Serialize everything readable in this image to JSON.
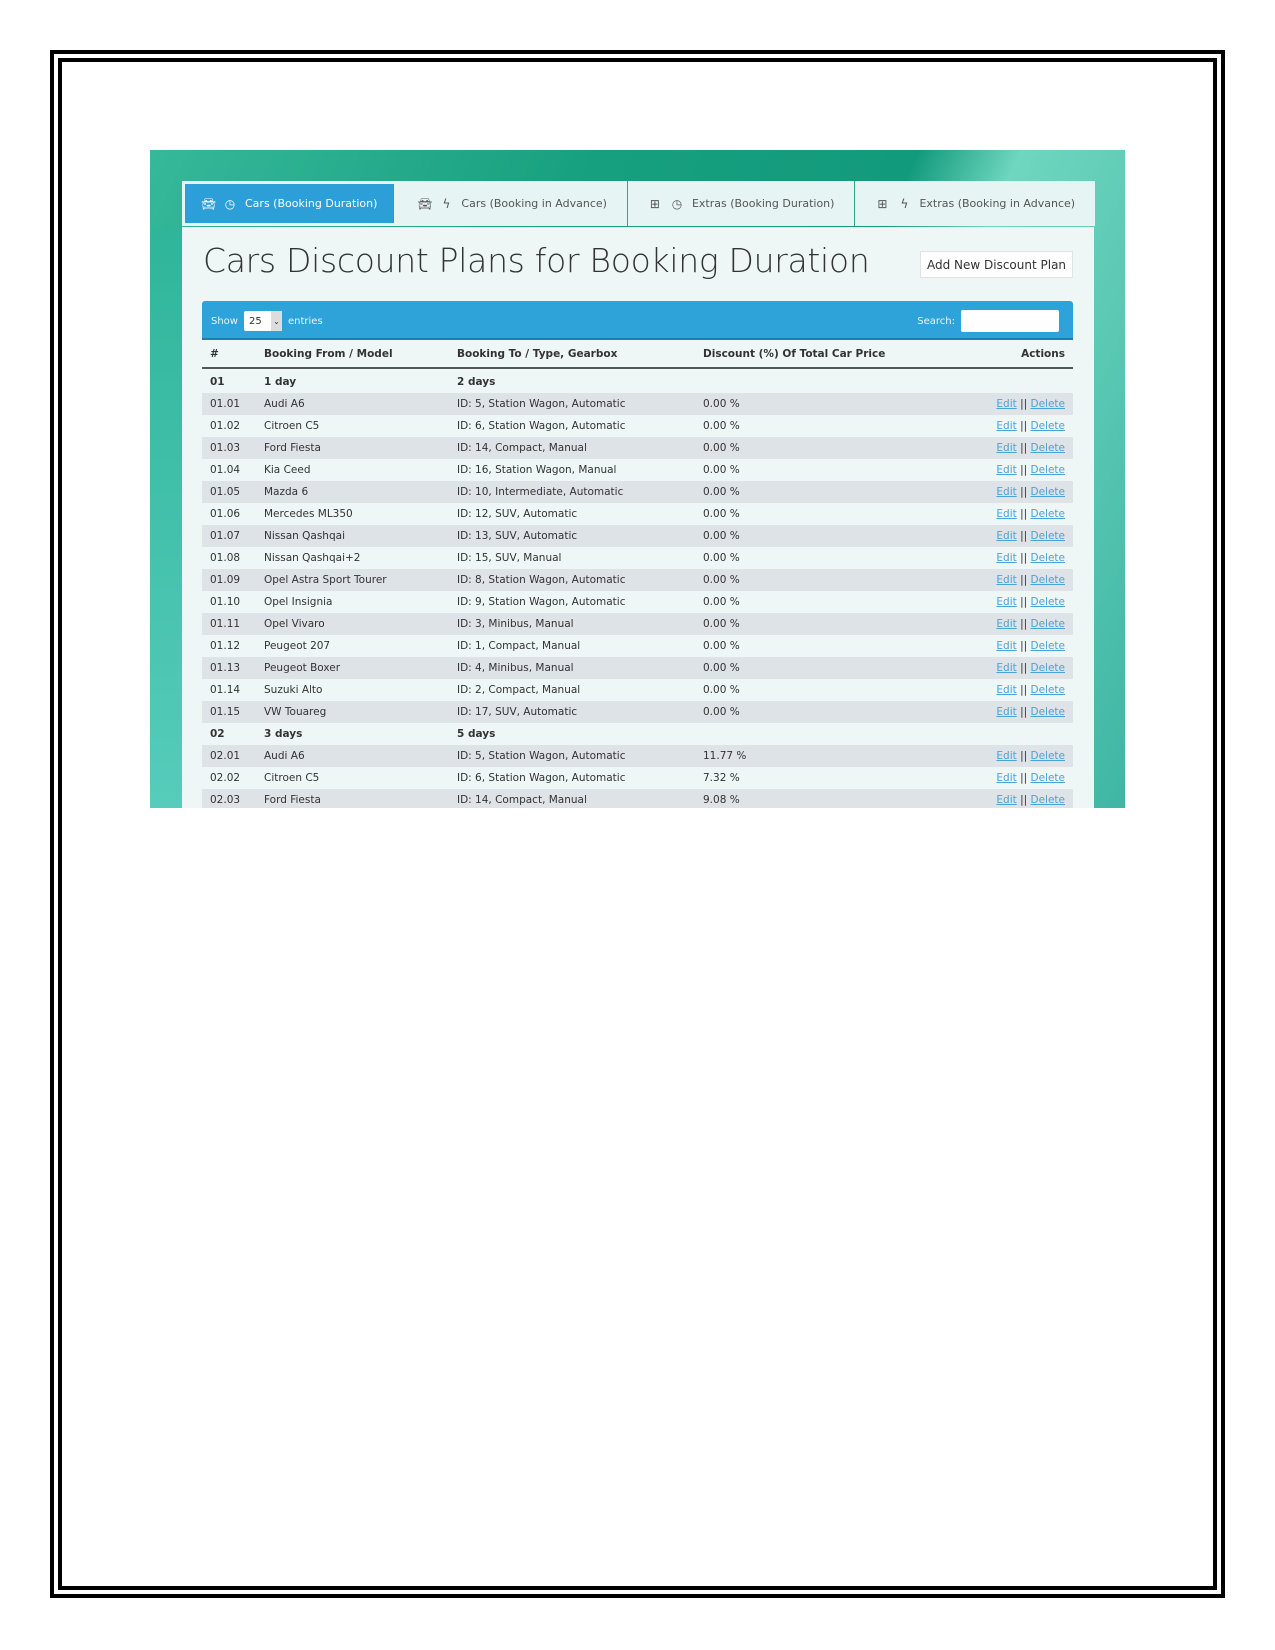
{
  "tabs": [
    {
      "label": "Cars (Booking Duration)",
      "icons": [
        "car-icon",
        "clock-icon"
      ],
      "active": true
    },
    {
      "label": "Cars (Booking in Advance)",
      "icons": [
        "car-icon",
        "bolt-icon"
      ]
    },
    {
      "label": "Extras (Booking Duration)",
      "icons": [
        "plus-square-icon",
        "clock-icon"
      ]
    },
    {
      "label": "Extras (Booking in Advance)",
      "icons": [
        "plus-square-icon",
        "bolt-icon"
      ]
    }
  ],
  "page_title": "Cars Discount Plans for Booking Duration",
  "add_button": "Add New Discount Plan",
  "toolbar": {
    "show_label": "Show",
    "entries_value": "25",
    "entries_label": "entries",
    "search_label": "Search:",
    "search_value": ""
  },
  "columns": [
    "#",
    "Booking From / Model",
    "Booking To / Type, Gearbox",
    "Discount (%) Of Total Car Price",
    "Actions"
  ],
  "action_labels": {
    "edit": "Edit",
    "separator": "||",
    "delete": "Delete"
  },
  "rows": [
    {
      "id": "01",
      "from": "1 day",
      "to": "2 days",
      "discount": "",
      "group": true
    },
    {
      "id": "01.01",
      "from": "Audi A6",
      "to": "ID: 5, Station Wagon, Automatic",
      "discount": "0.00 %"
    },
    {
      "id": "01.02",
      "from": "Citroen C5",
      "to": "ID: 6, Station Wagon, Automatic",
      "discount": "0.00 %"
    },
    {
      "id": "01.03",
      "from": "Ford Fiesta",
      "to": "ID: 14, Compact, Manual",
      "discount": "0.00 %"
    },
    {
      "id": "01.04",
      "from": "Kia Ceed",
      "to": "ID: 16, Station Wagon, Manual",
      "discount": "0.00 %"
    },
    {
      "id": "01.05",
      "from": "Mazda 6",
      "to": "ID: 10, Intermediate, Automatic",
      "discount": "0.00 %"
    },
    {
      "id": "01.06",
      "from": "Mercedes ML350",
      "to": "ID: 12, SUV, Automatic",
      "discount": "0.00 %"
    },
    {
      "id": "01.07",
      "from": "Nissan Qashqai",
      "to": "ID: 13, SUV, Automatic",
      "discount": "0.00 %"
    },
    {
      "id": "01.08",
      "from": "Nissan Qashqai+2",
      "to": "ID: 15, SUV, Manual",
      "discount": "0.00 %"
    },
    {
      "id": "01.09",
      "from": "Opel Astra Sport Tourer",
      "to": "ID: 8, Station Wagon, Automatic",
      "discount": "0.00 %"
    },
    {
      "id": "01.10",
      "from": "Opel Insignia",
      "to": "ID: 9, Station Wagon, Automatic",
      "discount": "0.00 %"
    },
    {
      "id": "01.11",
      "from": "Opel Vivaro",
      "to": "ID: 3, Minibus, Manual",
      "discount": "0.00 %"
    },
    {
      "id": "01.12",
      "from": "Peugeot 207",
      "to": "ID: 1, Compact, Manual",
      "discount": "0.00 %"
    },
    {
      "id": "01.13",
      "from": "Peugeot Boxer",
      "to": "ID: 4, Minibus, Manual",
      "discount": "0.00 %"
    },
    {
      "id": "01.14",
      "from": "Suzuki Alto",
      "to": "ID: 2, Compact, Manual",
      "discount": "0.00 %"
    },
    {
      "id": "01.15",
      "from": "VW Touareg",
      "to": "ID: 17, SUV, Automatic",
      "discount": "0.00 %"
    },
    {
      "id": "02",
      "from": "3 days",
      "to": "5 days",
      "discount": "",
      "group": true
    },
    {
      "id": "02.01",
      "from": "Audi A6",
      "to": "ID: 5, Station Wagon, Automatic",
      "discount": "11.77 %"
    },
    {
      "id": "02.02",
      "from": "Citroen C5",
      "to": "ID: 6, Station Wagon, Automatic",
      "discount": "7.32 %"
    },
    {
      "id": "02.03",
      "from": "Ford Fiesta",
      "to": "ID: 14, Compact, Manual",
      "discount": "9.08 %"
    }
  ]
}
